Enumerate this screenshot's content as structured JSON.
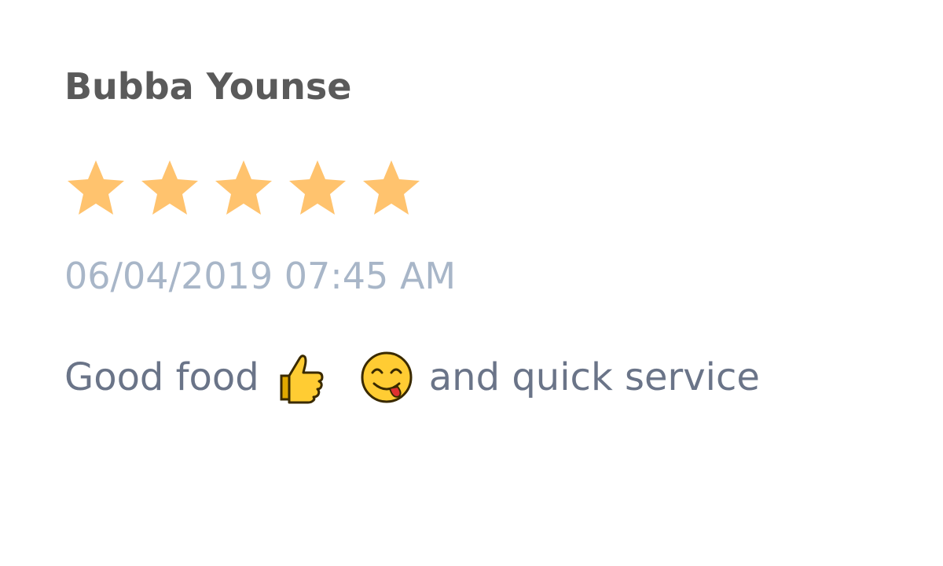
{
  "review": {
    "reviewer_name": "Bubba Younse",
    "rating": 5,
    "rating_max": 5,
    "date": "06/04/2019 07:45 AM",
    "text_before": "Good food",
    "emoji_1": "thumbs-up-icon",
    "emoji_2": "face-savoring-food-icon",
    "text_after": "and quick service"
  },
  "colors": {
    "name": "#5a5a5a",
    "star": "#ffc36e",
    "date": "#a8b6c8",
    "text": "#6a7488"
  }
}
